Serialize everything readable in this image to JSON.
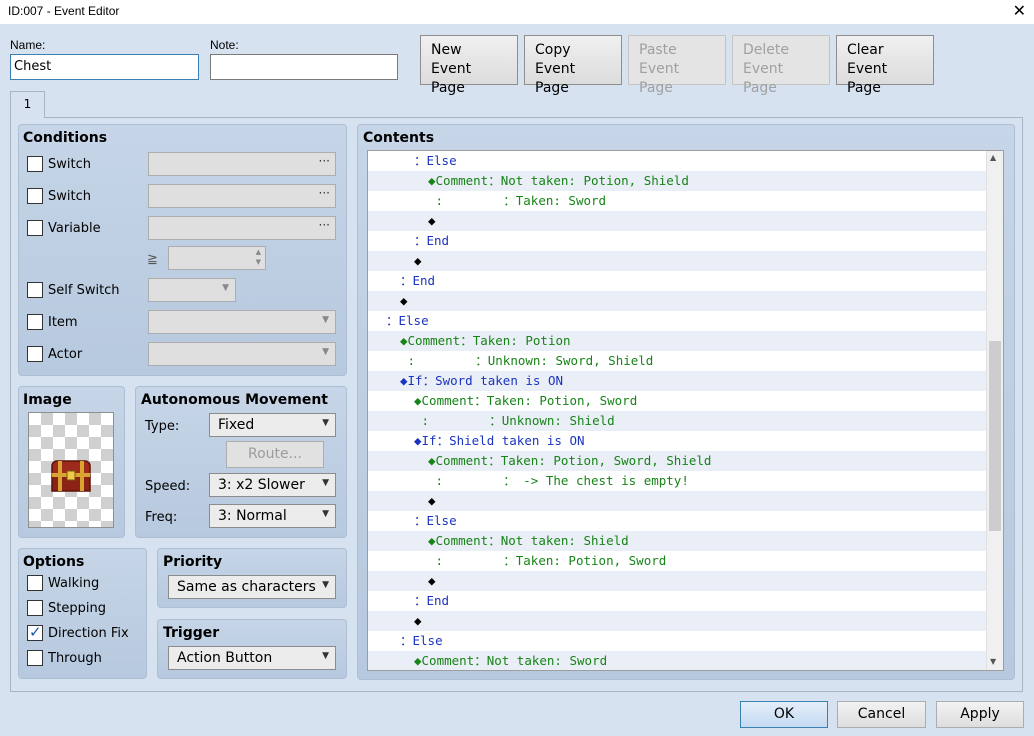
{
  "window": {
    "title": "ID:007 - Event Editor",
    "close_glyph": "✕"
  },
  "name": {
    "label": "Name:",
    "value": "Chest"
  },
  "note": {
    "label": "Note:",
    "value": ""
  },
  "page_buttons": {
    "new": "New\nEvent Page",
    "copy": "Copy\nEvent Page",
    "paste": "Paste\nEvent Page",
    "delete": "Delete\nEvent Page",
    "clear": "Clear\nEvent Page"
  },
  "tabs": [
    {
      "label": "1"
    }
  ],
  "conditions": {
    "title": "Conditions",
    "switch1": "Switch",
    "switch2": "Switch",
    "variable": "Variable",
    "gte": "≧",
    "self_switch": "Self Switch",
    "item": "Item",
    "actor": "Actor",
    "dots": "···"
  },
  "image": {
    "title": "Image"
  },
  "movement": {
    "title": "Autonomous Movement",
    "type_label": "Type:",
    "type_value": "Fixed",
    "route_button": "Route...",
    "speed_label": "Speed:",
    "speed_value": "3: x2 Slower",
    "freq_label": "Freq:",
    "freq_value": "3: Normal"
  },
  "options": {
    "title": "Options",
    "walking": "Walking",
    "walking_checked": false,
    "stepping": "Stepping",
    "stepping_checked": false,
    "direction_fix": "Direction Fix",
    "direction_fix_checked": true,
    "through": "Through",
    "through_checked": false
  },
  "priority": {
    "title": "Priority",
    "value": "Same as characters"
  },
  "trigger": {
    "title": "Trigger",
    "value": "Action Button"
  },
  "contents": {
    "title": "Contents",
    "lines": [
      {
        "indent": 3,
        "text": "：Else",
        "color": "blue"
      },
      {
        "indent": 4,
        "text": "◆Comment：Not taken: Potion, Shield",
        "color": "green"
      },
      {
        "indent": 4,
        "text": " :        ：Taken: Sword",
        "color": "green"
      },
      {
        "indent": 4,
        "text": "◆",
        "color": "black"
      },
      {
        "indent": 3,
        "text": "：End",
        "color": "blue"
      },
      {
        "indent": 3,
        "text": "◆",
        "color": "black"
      },
      {
        "indent": 2,
        "text": "：End",
        "color": "blue"
      },
      {
        "indent": 2,
        "text": "◆",
        "color": "black"
      },
      {
        "indent": 1,
        "text": "：Else",
        "color": "blue"
      },
      {
        "indent": 2,
        "text": "◆Comment：Taken: Potion",
        "color": "green"
      },
      {
        "indent": 2,
        "text": " :        ：Unknown: Sword, Shield",
        "color": "green"
      },
      {
        "indent": 2,
        "text": "◆If：Sword taken is ON",
        "color": "blue"
      },
      {
        "indent": 3,
        "text": "◆Comment：Taken: Potion, Sword",
        "color": "green"
      },
      {
        "indent": 3,
        "text": " :        ：Unknown: Shield",
        "color": "green"
      },
      {
        "indent": 3,
        "text": "◆If：Shield taken is ON",
        "color": "blue"
      },
      {
        "indent": 4,
        "text": "◆Comment：Taken: Potion, Sword, Shield",
        "color": "green"
      },
      {
        "indent": 4,
        "text": " :        ： -> The chest is empty!",
        "color": "green"
      },
      {
        "indent": 4,
        "text": "◆",
        "color": "black"
      },
      {
        "indent": 3,
        "text": "：Else",
        "color": "blue"
      },
      {
        "indent": 4,
        "text": "◆Comment：Not taken: Shield",
        "color": "green"
      },
      {
        "indent": 4,
        "text": " :        ：Taken: Potion, Sword",
        "color": "green"
      },
      {
        "indent": 4,
        "text": "◆",
        "color": "black"
      },
      {
        "indent": 3,
        "text": "：End",
        "color": "blue"
      },
      {
        "indent": 3,
        "text": "◆",
        "color": "black"
      },
      {
        "indent": 2,
        "text": "：Else",
        "color": "blue"
      },
      {
        "indent": 3,
        "text": "◆Comment：Not taken: Sword",
        "color": "green"
      }
    ]
  },
  "footer": {
    "ok": "OK",
    "cancel": "Cancel",
    "apply": "Apply"
  },
  "colors": {
    "blue": "#1b34c0",
    "green": "#178417",
    "black": "#000000",
    "panel": "#d6e2f0"
  }
}
